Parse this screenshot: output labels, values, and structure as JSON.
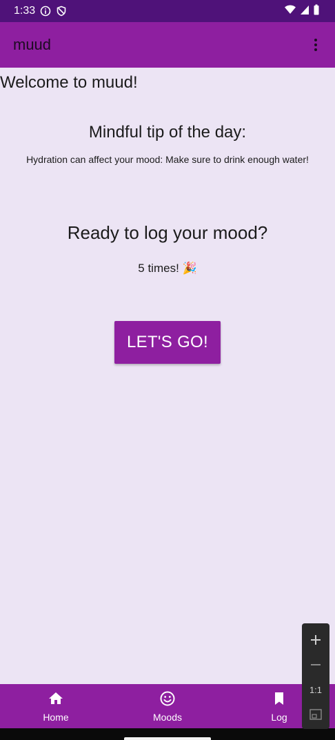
{
  "status_bar": {
    "time": "1:33",
    "icons": [
      "info-icon",
      "shield-icon",
      "wifi-icon",
      "signal-icon",
      "battery-icon"
    ]
  },
  "app_bar": {
    "title": "muud",
    "menu_icon": "more-vert-icon"
  },
  "main": {
    "welcome": "Welcome to muud!",
    "tip_heading": "Mindful tip of the day:",
    "tip_text": "Hydration can affect your mood: Make sure to drink enough water!",
    "ready_heading": "Ready to log your mood?",
    "times_text": "5 times! 🎉",
    "go_button": "LET'S GO!"
  },
  "zoom_controls": {
    "plus": "+",
    "minus": "−",
    "one_to_one": "1:1"
  },
  "bottom_nav": {
    "items": [
      {
        "label": "Home",
        "icon": "home-icon"
      },
      {
        "label": "Moods",
        "icon": "smiley-icon"
      },
      {
        "label": "Log",
        "icon": "bookmark-icon"
      }
    ]
  },
  "colors": {
    "status_bar": "#4f1279",
    "primary": "#8e1fa0",
    "background": "#ece4f4",
    "on_primary": "#ffffff"
  }
}
